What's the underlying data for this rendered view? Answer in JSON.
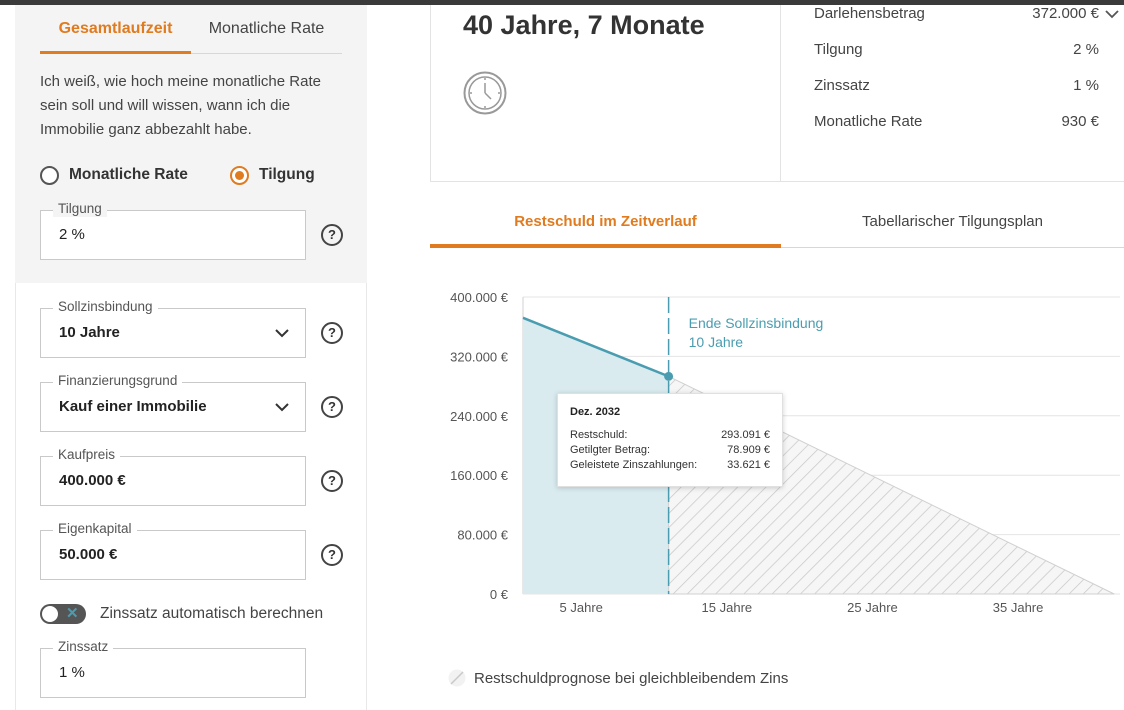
{
  "tabs_left": {
    "active": "Gesamtlaufzeit",
    "inactive": "Monatliche Rate"
  },
  "description": "Ich weiß, wie hoch meine monatliche Rate sein soll und will wissen, wann ich die Immobilie ganz abbezahlt habe.",
  "radio": {
    "option1": "Monatliche Rate",
    "option2": "Tilgung",
    "selected": "Tilgung"
  },
  "fields": {
    "tilgung": {
      "label": "Tilgung",
      "value": "2 %"
    },
    "sollzinsbindung": {
      "label": "Sollzinsbindung",
      "value": "10 Jahre"
    },
    "finanzierungsgrund": {
      "label": "Finanzierungsgrund",
      "value": "Kauf einer Immobilie"
    },
    "kaufpreis": {
      "label": "Kaufpreis",
      "value": "400.000 €"
    },
    "eigenkapital": {
      "label": "Eigenkapital",
      "value": "50.000 €"
    },
    "zinssatz": {
      "label": "Zinssatz",
      "value": "1 %"
    }
  },
  "help_symbol": "?",
  "toggle": {
    "label": "Zinssatz automatisch berechnen",
    "on": false,
    "off_mark": "✕"
  },
  "summary": {
    "duration": "40 Jahre, 7 Monate",
    "rows": [
      {
        "key": "Darlehensbetrag",
        "value": "372.000 €"
      },
      {
        "key": "Tilgung",
        "value": "2 %"
      },
      {
        "key": "Zinssatz",
        "value": "1 %"
      },
      {
        "key": "Monatliche Rate",
        "value": "930 €"
      }
    ]
  },
  "tabs_right": {
    "active": "Restschuld im Zeitverlauf",
    "inactive": "Tabellarischer Tilgungsplan"
  },
  "tooltip": {
    "title": "Dez. 2032",
    "rows": [
      {
        "key": "Restschuld:",
        "value": "293.091 €"
      },
      {
        "key": "Getilgter Betrag:",
        "value": "78.909 €"
      },
      {
        "key": "Geleistete Zinszahlungen:",
        "value": "33.621 €"
      }
    ]
  },
  "legend": {
    "label": "Restschuldprognose bei gleichbleibendem Zins"
  },
  "colors": {
    "accent": "#e07b1f",
    "chart_line": "#4a9db0",
    "chart_fill": "#d9ebef"
  },
  "chart_data": {
    "type": "area",
    "y_ticks": [
      "400.000 €",
      "320.000 €",
      "240.000 €",
      "160.000 €",
      "80.000 €",
      "0 €"
    ],
    "y_tick_values": [
      400000,
      320000,
      240000,
      160000,
      80000,
      0
    ],
    "x_ticks": [
      "5 Jahre",
      "15 Jahre",
      "25 Jahre",
      "35 Jahre"
    ],
    "x_tick_values": [
      5,
      15,
      25,
      35
    ],
    "xlim": [
      1,
      42
    ],
    "ylim": [
      0,
      400000
    ],
    "grid": true,
    "annotation": {
      "label_line1": "Ende Sollzinsbindung",
      "label_line2": "10 Jahre",
      "x": 11
    },
    "series": [
      {
        "x": [
          1,
          11
        ],
        "y": [
          372000,
          293091
        ]
      },
      {
        "x": [
          11,
          41.6
        ],
        "y": [
          293091,
          0
        ]
      }
    ]
  }
}
